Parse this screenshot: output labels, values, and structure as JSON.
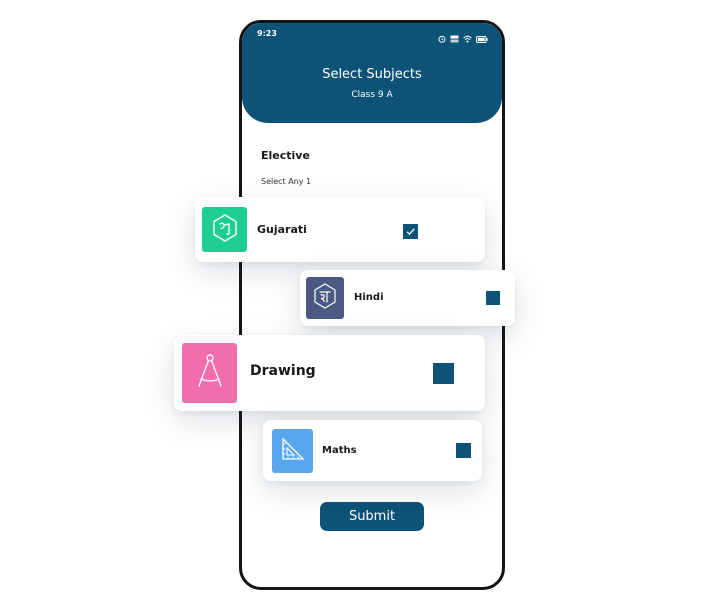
{
  "status_bar": {
    "time": "9:23",
    "icons": [
      "alarm-icon",
      "network-speed-icon",
      "wifi-icon",
      "battery-icon"
    ]
  },
  "header": {
    "title": "Select Subjects",
    "subtitle": "Class 9 A"
  },
  "section": {
    "heading": "Elective",
    "hint": "Select Any 1"
  },
  "subjects": [
    {
      "label": "Gujarati",
      "icon": "gujarati-letter-icon",
      "tile_color": "#1fce95",
      "checked": true
    },
    {
      "label": "Hindi",
      "icon": "hindi-letter-icon",
      "tile_color": "#4a5a82",
      "checked": false
    },
    {
      "label": "Drawing",
      "icon": "compass-icon",
      "tile_color": "#f26fae",
      "checked": false
    },
    {
      "label": "Maths",
      "icon": "set-square-icon",
      "tile_color": "#5aa6ee",
      "checked": false
    }
  ],
  "submit_label": "Submit",
  "colors": {
    "primary": "#0d5277",
    "background": "#ffffff"
  }
}
